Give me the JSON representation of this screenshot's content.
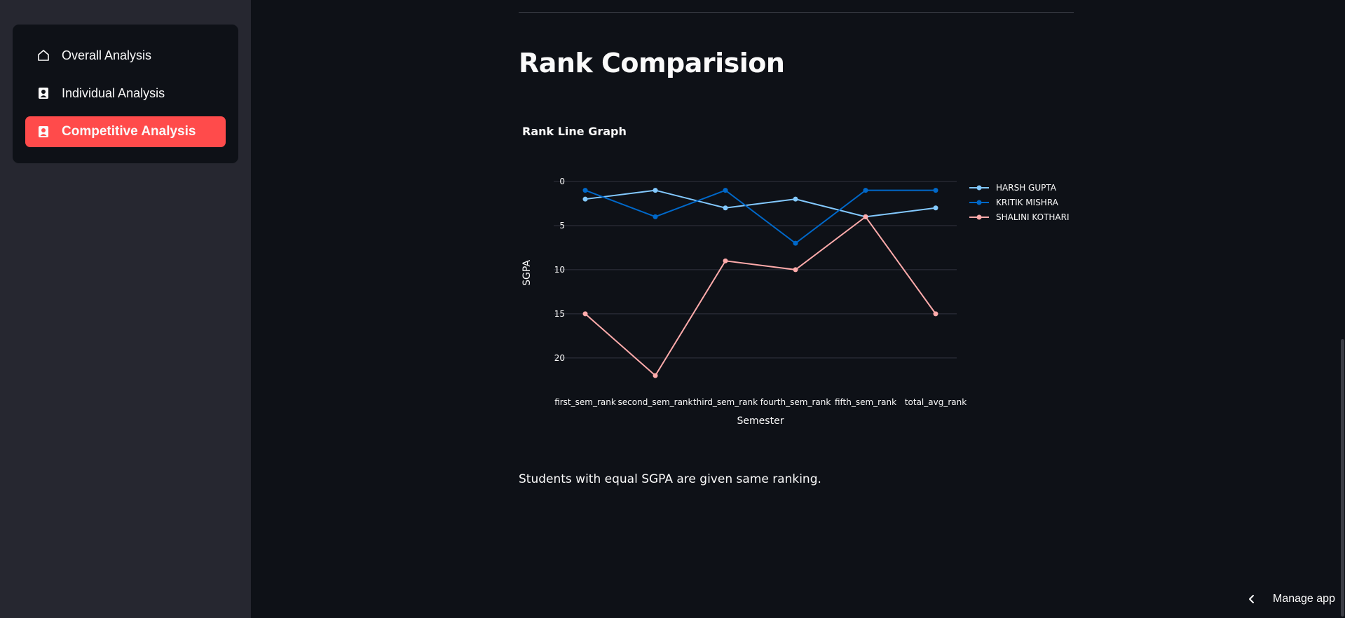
{
  "sidebar": {
    "items": [
      {
        "label": "Overall Analysis",
        "icon": "home-icon",
        "active": false
      },
      {
        "label": "Individual Analysis",
        "icon": "person-badge-icon",
        "active": false
      },
      {
        "label": "Competitive Analysis",
        "icon": "person-badge-icon",
        "active": true
      }
    ],
    "active_color": "#ff4b4b"
  },
  "main": {
    "title": "Rank Comparision",
    "chart_heading": "Rank Line Graph",
    "note": "Students with equal SGPA are given same ranking."
  },
  "footer": {
    "manage_label": "Manage app"
  },
  "chart_data": {
    "type": "line",
    "title": "Rank Line Graph",
    "xlabel": "Semester",
    "ylabel": "SGPA",
    "categories": [
      "first_sem_rank",
      "second_sem_rank",
      "third_sem_rank",
      "fourth_sem_rank",
      "fifth_sem_rank",
      "total_avg_rank"
    ],
    "ylim": [
      0,
      22
    ],
    "y_reversed": true,
    "yticks": [
      0,
      5,
      10,
      15,
      20
    ],
    "grid": true,
    "legend_position": "right",
    "series": [
      {
        "name": "HARSH GUPTA",
        "color": "#83c9ff",
        "values": [
          2,
          1,
          3,
          2,
          4,
          3
        ]
      },
      {
        "name": "KRITIK MISHRA",
        "color": "#0068c9",
        "values": [
          1,
          4,
          1,
          7,
          1,
          1
        ]
      },
      {
        "name": "SHALINI KOTHARI",
        "color": "#ffabab",
        "values": [
          15,
          22,
          9,
          10,
          4,
          15
        ]
      }
    ]
  }
}
